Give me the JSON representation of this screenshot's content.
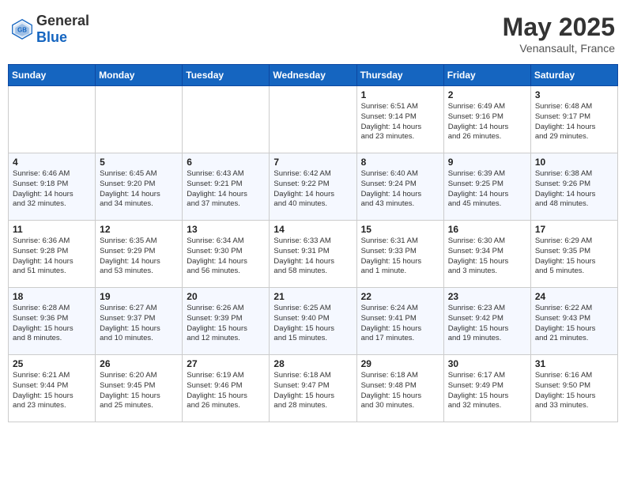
{
  "header": {
    "logo_general": "General",
    "logo_blue": "Blue",
    "title": "May 2025",
    "location": "Venansault, France"
  },
  "days_of_week": [
    "Sunday",
    "Monday",
    "Tuesday",
    "Wednesday",
    "Thursday",
    "Friday",
    "Saturday"
  ],
  "weeks": [
    [
      {
        "day": "",
        "info": ""
      },
      {
        "day": "",
        "info": ""
      },
      {
        "day": "",
        "info": ""
      },
      {
        "day": "",
        "info": ""
      },
      {
        "day": "1",
        "info": "Sunrise: 6:51 AM\nSunset: 9:14 PM\nDaylight: 14 hours\nand 23 minutes."
      },
      {
        "day": "2",
        "info": "Sunrise: 6:49 AM\nSunset: 9:16 PM\nDaylight: 14 hours\nand 26 minutes."
      },
      {
        "day": "3",
        "info": "Sunrise: 6:48 AM\nSunset: 9:17 PM\nDaylight: 14 hours\nand 29 minutes."
      }
    ],
    [
      {
        "day": "4",
        "info": "Sunrise: 6:46 AM\nSunset: 9:18 PM\nDaylight: 14 hours\nand 32 minutes."
      },
      {
        "day": "5",
        "info": "Sunrise: 6:45 AM\nSunset: 9:20 PM\nDaylight: 14 hours\nand 34 minutes."
      },
      {
        "day": "6",
        "info": "Sunrise: 6:43 AM\nSunset: 9:21 PM\nDaylight: 14 hours\nand 37 minutes."
      },
      {
        "day": "7",
        "info": "Sunrise: 6:42 AM\nSunset: 9:22 PM\nDaylight: 14 hours\nand 40 minutes."
      },
      {
        "day": "8",
        "info": "Sunrise: 6:40 AM\nSunset: 9:24 PM\nDaylight: 14 hours\nand 43 minutes."
      },
      {
        "day": "9",
        "info": "Sunrise: 6:39 AM\nSunset: 9:25 PM\nDaylight: 14 hours\nand 45 minutes."
      },
      {
        "day": "10",
        "info": "Sunrise: 6:38 AM\nSunset: 9:26 PM\nDaylight: 14 hours\nand 48 minutes."
      }
    ],
    [
      {
        "day": "11",
        "info": "Sunrise: 6:36 AM\nSunset: 9:28 PM\nDaylight: 14 hours\nand 51 minutes."
      },
      {
        "day": "12",
        "info": "Sunrise: 6:35 AM\nSunset: 9:29 PM\nDaylight: 14 hours\nand 53 minutes."
      },
      {
        "day": "13",
        "info": "Sunrise: 6:34 AM\nSunset: 9:30 PM\nDaylight: 14 hours\nand 56 minutes."
      },
      {
        "day": "14",
        "info": "Sunrise: 6:33 AM\nSunset: 9:31 PM\nDaylight: 14 hours\nand 58 minutes."
      },
      {
        "day": "15",
        "info": "Sunrise: 6:31 AM\nSunset: 9:33 PM\nDaylight: 15 hours\nand 1 minute."
      },
      {
        "day": "16",
        "info": "Sunrise: 6:30 AM\nSunset: 9:34 PM\nDaylight: 15 hours\nand 3 minutes."
      },
      {
        "day": "17",
        "info": "Sunrise: 6:29 AM\nSunset: 9:35 PM\nDaylight: 15 hours\nand 5 minutes."
      }
    ],
    [
      {
        "day": "18",
        "info": "Sunrise: 6:28 AM\nSunset: 9:36 PM\nDaylight: 15 hours\nand 8 minutes."
      },
      {
        "day": "19",
        "info": "Sunrise: 6:27 AM\nSunset: 9:37 PM\nDaylight: 15 hours\nand 10 minutes."
      },
      {
        "day": "20",
        "info": "Sunrise: 6:26 AM\nSunset: 9:39 PM\nDaylight: 15 hours\nand 12 minutes."
      },
      {
        "day": "21",
        "info": "Sunrise: 6:25 AM\nSunset: 9:40 PM\nDaylight: 15 hours\nand 15 minutes."
      },
      {
        "day": "22",
        "info": "Sunrise: 6:24 AM\nSunset: 9:41 PM\nDaylight: 15 hours\nand 17 minutes."
      },
      {
        "day": "23",
        "info": "Sunrise: 6:23 AM\nSunset: 9:42 PM\nDaylight: 15 hours\nand 19 minutes."
      },
      {
        "day": "24",
        "info": "Sunrise: 6:22 AM\nSunset: 9:43 PM\nDaylight: 15 hours\nand 21 minutes."
      }
    ],
    [
      {
        "day": "25",
        "info": "Sunrise: 6:21 AM\nSunset: 9:44 PM\nDaylight: 15 hours\nand 23 minutes."
      },
      {
        "day": "26",
        "info": "Sunrise: 6:20 AM\nSunset: 9:45 PM\nDaylight: 15 hours\nand 25 minutes."
      },
      {
        "day": "27",
        "info": "Sunrise: 6:19 AM\nSunset: 9:46 PM\nDaylight: 15 hours\nand 26 minutes."
      },
      {
        "day": "28",
        "info": "Sunrise: 6:18 AM\nSunset: 9:47 PM\nDaylight: 15 hours\nand 28 minutes."
      },
      {
        "day": "29",
        "info": "Sunrise: 6:18 AM\nSunset: 9:48 PM\nDaylight: 15 hours\nand 30 minutes."
      },
      {
        "day": "30",
        "info": "Sunrise: 6:17 AM\nSunset: 9:49 PM\nDaylight: 15 hours\nand 32 minutes."
      },
      {
        "day": "31",
        "info": "Sunrise: 6:16 AM\nSunset: 9:50 PM\nDaylight: 15 hours\nand 33 minutes."
      }
    ]
  ]
}
